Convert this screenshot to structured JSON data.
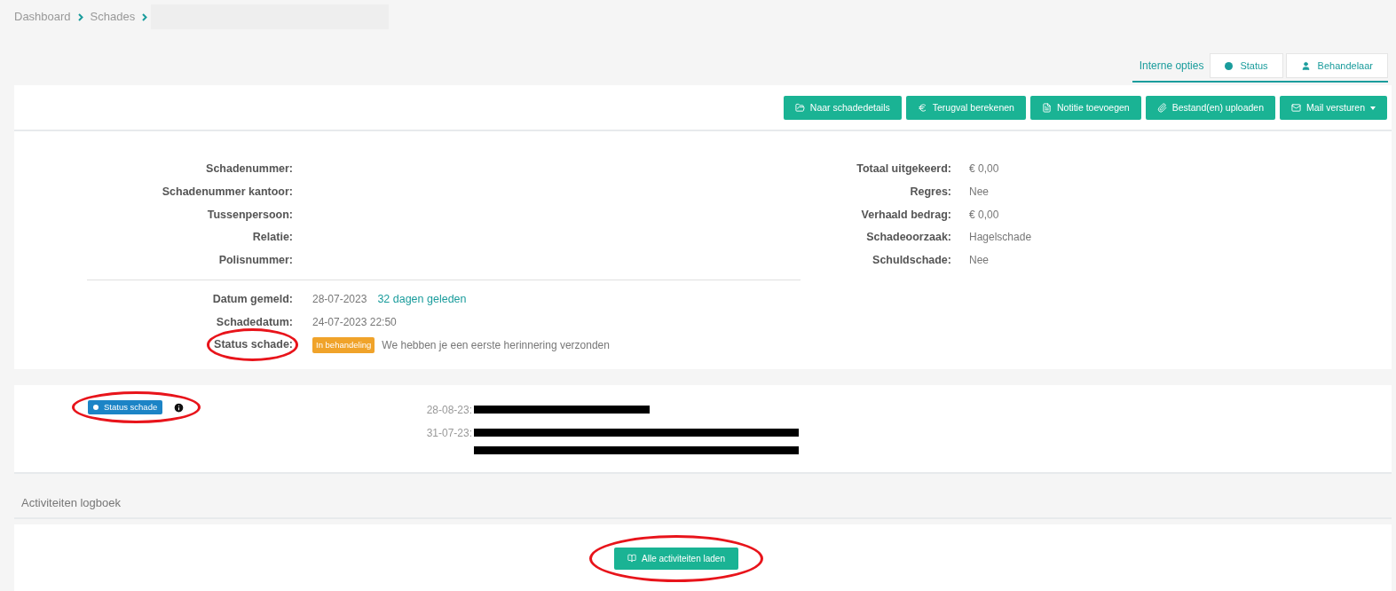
{
  "breadcrumb": [
    {
      "label": "Dashboard"
    },
    {
      "label": "Schades"
    }
  ],
  "internal_options": {
    "label": "Interne opties",
    "buttons": [
      {
        "label": "Status",
        "kind": "status"
      },
      {
        "label": "Behandelaar",
        "kind": "user"
      }
    ]
  },
  "toolbar": [
    {
      "label": "Naar schadedetails",
      "kind": "folder",
      "dropdown": false
    },
    {
      "label": "Terugval berekenen",
      "kind": "euro",
      "dropdown": false
    },
    {
      "label": "Notitie toevoegen",
      "kind": "note",
      "dropdown": false
    },
    {
      "label": "Bestand(en) uploaden",
      "kind": "paperclip",
      "dropdown": false
    },
    {
      "label": "Mail versturen",
      "kind": "mail",
      "dropdown": true
    }
  ],
  "details_left": [
    {
      "label": "Schadenummer:"
    },
    {
      "label": "Schadenummer kantoor:"
    },
    {
      "label": "Tussenpersoon:"
    },
    {
      "label": "Relatie:"
    },
    {
      "label": "Polisnummer:"
    }
  ],
  "details_right": [
    {
      "label": "Totaal uitgekeerd:",
      "value": "€ 0,00"
    },
    {
      "label": "Regres:",
      "value": "Nee"
    },
    {
      "label": "Verhaald bedrag:",
      "value": "€ 0,00"
    },
    {
      "label": "Schadeoorzaak:",
      "value": "Hagelschade"
    },
    {
      "label": "Schuldschade:",
      "value": "Nee"
    }
  ],
  "dates": [
    {
      "label": "Datum gemeld:",
      "value": "28-07-2023",
      "link": "32 dagen geleden"
    },
    {
      "label": "Schadedatum:",
      "value": "24-07-2023 22:50"
    }
  ],
  "status": {
    "label": "Status schade:",
    "circled": true,
    "badge": "In behandeling",
    "message": "We hebben je een eerste herinnering verzonden"
  },
  "status_panel": {
    "button": "Status schade",
    "circled": true,
    "entries": [
      {
        "date": "28-08-23:",
        "lines": [
          {
            "kind": "short"
          }
        ]
      },
      {
        "date": "31-07-23:",
        "lines": [
          {
            "kind": "long"
          },
          {
            "kind": "long"
          }
        ]
      }
    ]
  },
  "activity_log": {
    "title": "Activiteiten logboek",
    "button": "Alle activiteiten laden",
    "circled": true
  }
}
